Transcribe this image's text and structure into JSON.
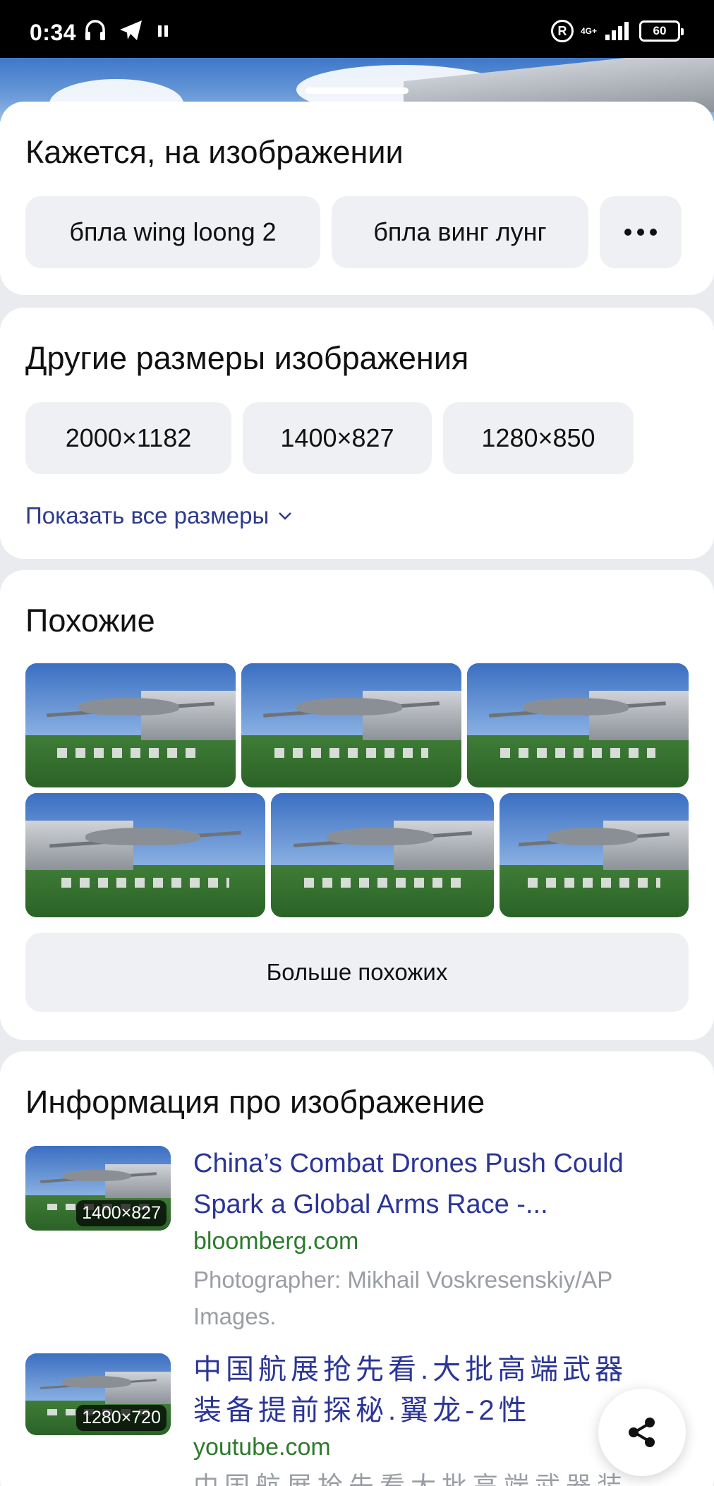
{
  "status_bar": {
    "time": "0:34",
    "network": "4G+",
    "battery": "60",
    "battery_level": 0.6
  },
  "sections": {
    "seems": {
      "title": "Кажется, на изображении",
      "chips": [
        "бпла wing loong 2",
        "бпла винг лунг"
      ],
      "more_label": "•••"
    },
    "sizes": {
      "title": "Другие размеры изображения",
      "chips": [
        "2000×1182",
        "1400×827",
        "1280×850"
      ],
      "show_all": "Показать все размеры"
    },
    "similar": {
      "title": "Похожие",
      "more_button": "Больше похожих"
    },
    "info": {
      "title": "Информация про изображение",
      "items": [
        {
          "badge": "1400×827",
          "title": "China’s Combat Drones Push Could Spark a Global Arms Race -...",
          "source": "bloomberg.com",
          "description": "Photographer: Mikhail Voskresenskiy/AP Images."
        },
        {
          "badge": "1280×720",
          "title": "中国航展抢先看.大批高端武器装备提前探秘.翼龙-2性",
          "source": "youtube.com",
          "description": "中国航展抢先看大批高端武器装"
        }
      ]
    }
  },
  "icons": {
    "headphones": "headphones-icon",
    "telegram": "telegram-icon",
    "pause": "pause-icon",
    "registered": "registered-icon",
    "signal": "signal-icon",
    "battery": "battery-icon",
    "chevron": "chevron-down-icon",
    "share": "share-icon"
  }
}
